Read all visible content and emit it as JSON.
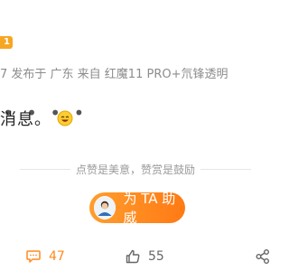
{
  "header": {
    "level": "1",
    "meta": "7 发布于 广东 来自 红魔11 PRO+氘锋透明"
  },
  "post": {
    "dots": "• • • •",
    "text": "消息。"
  },
  "reward": {
    "tagline": "点赞是美意，赞赏是鼓励",
    "button_label": "为 TA 助威"
  },
  "actions": {
    "comment_count": "47",
    "like_count": "55"
  },
  "colors": {
    "accent": "#ff8a1f",
    "badge": "#f5a623"
  }
}
